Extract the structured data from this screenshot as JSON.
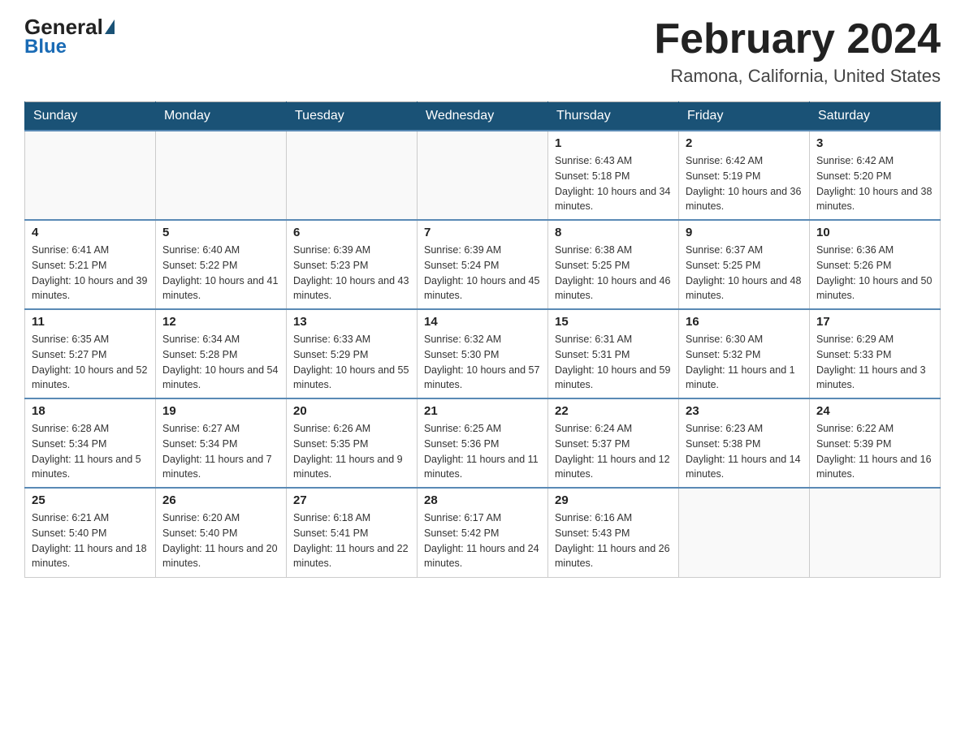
{
  "logo": {
    "general": "General",
    "blue": "Blue"
  },
  "title": "February 2024",
  "subtitle": "Ramona, California, United States",
  "days_of_week": [
    "Sunday",
    "Monday",
    "Tuesday",
    "Wednesday",
    "Thursday",
    "Friday",
    "Saturday"
  ],
  "weeks": [
    [
      {
        "day": "",
        "info": ""
      },
      {
        "day": "",
        "info": ""
      },
      {
        "day": "",
        "info": ""
      },
      {
        "day": "",
        "info": ""
      },
      {
        "day": "1",
        "info": "Sunrise: 6:43 AM\nSunset: 5:18 PM\nDaylight: 10 hours and 34 minutes."
      },
      {
        "day": "2",
        "info": "Sunrise: 6:42 AM\nSunset: 5:19 PM\nDaylight: 10 hours and 36 minutes."
      },
      {
        "day": "3",
        "info": "Sunrise: 6:42 AM\nSunset: 5:20 PM\nDaylight: 10 hours and 38 minutes."
      }
    ],
    [
      {
        "day": "4",
        "info": "Sunrise: 6:41 AM\nSunset: 5:21 PM\nDaylight: 10 hours and 39 minutes."
      },
      {
        "day": "5",
        "info": "Sunrise: 6:40 AM\nSunset: 5:22 PM\nDaylight: 10 hours and 41 minutes."
      },
      {
        "day": "6",
        "info": "Sunrise: 6:39 AM\nSunset: 5:23 PM\nDaylight: 10 hours and 43 minutes."
      },
      {
        "day": "7",
        "info": "Sunrise: 6:39 AM\nSunset: 5:24 PM\nDaylight: 10 hours and 45 minutes."
      },
      {
        "day": "8",
        "info": "Sunrise: 6:38 AM\nSunset: 5:25 PM\nDaylight: 10 hours and 46 minutes."
      },
      {
        "day": "9",
        "info": "Sunrise: 6:37 AM\nSunset: 5:25 PM\nDaylight: 10 hours and 48 minutes."
      },
      {
        "day": "10",
        "info": "Sunrise: 6:36 AM\nSunset: 5:26 PM\nDaylight: 10 hours and 50 minutes."
      }
    ],
    [
      {
        "day": "11",
        "info": "Sunrise: 6:35 AM\nSunset: 5:27 PM\nDaylight: 10 hours and 52 minutes."
      },
      {
        "day": "12",
        "info": "Sunrise: 6:34 AM\nSunset: 5:28 PM\nDaylight: 10 hours and 54 minutes."
      },
      {
        "day": "13",
        "info": "Sunrise: 6:33 AM\nSunset: 5:29 PM\nDaylight: 10 hours and 55 minutes."
      },
      {
        "day": "14",
        "info": "Sunrise: 6:32 AM\nSunset: 5:30 PM\nDaylight: 10 hours and 57 minutes."
      },
      {
        "day": "15",
        "info": "Sunrise: 6:31 AM\nSunset: 5:31 PM\nDaylight: 10 hours and 59 minutes."
      },
      {
        "day": "16",
        "info": "Sunrise: 6:30 AM\nSunset: 5:32 PM\nDaylight: 11 hours and 1 minute."
      },
      {
        "day": "17",
        "info": "Sunrise: 6:29 AM\nSunset: 5:33 PM\nDaylight: 11 hours and 3 minutes."
      }
    ],
    [
      {
        "day": "18",
        "info": "Sunrise: 6:28 AM\nSunset: 5:34 PM\nDaylight: 11 hours and 5 minutes."
      },
      {
        "day": "19",
        "info": "Sunrise: 6:27 AM\nSunset: 5:34 PM\nDaylight: 11 hours and 7 minutes."
      },
      {
        "day": "20",
        "info": "Sunrise: 6:26 AM\nSunset: 5:35 PM\nDaylight: 11 hours and 9 minutes."
      },
      {
        "day": "21",
        "info": "Sunrise: 6:25 AM\nSunset: 5:36 PM\nDaylight: 11 hours and 11 minutes."
      },
      {
        "day": "22",
        "info": "Sunrise: 6:24 AM\nSunset: 5:37 PM\nDaylight: 11 hours and 12 minutes."
      },
      {
        "day": "23",
        "info": "Sunrise: 6:23 AM\nSunset: 5:38 PM\nDaylight: 11 hours and 14 minutes."
      },
      {
        "day": "24",
        "info": "Sunrise: 6:22 AM\nSunset: 5:39 PM\nDaylight: 11 hours and 16 minutes."
      }
    ],
    [
      {
        "day": "25",
        "info": "Sunrise: 6:21 AM\nSunset: 5:40 PM\nDaylight: 11 hours and 18 minutes."
      },
      {
        "day": "26",
        "info": "Sunrise: 6:20 AM\nSunset: 5:40 PM\nDaylight: 11 hours and 20 minutes."
      },
      {
        "day": "27",
        "info": "Sunrise: 6:18 AM\nSunset: 5:41 PM\nDaylight: 11 hours and 22 minutes."
      },
      {
        "day": "28",
        "info": "Sunrise: 6:17 AM\nSunset: 5:42 PM\nDaylight: 11 hours and 24 minutes."
      },
      {
        "day": "29",
        "info": "Sunrise: 6:16 AM\nSunset: 5:43 PM\nDaylight: 11 hours and 26 minutes."
      },
      {
        "day": "",
        "info": ""
      },
      {
        "day": "",
        "info": ""
      }
    ]
  ]
}
